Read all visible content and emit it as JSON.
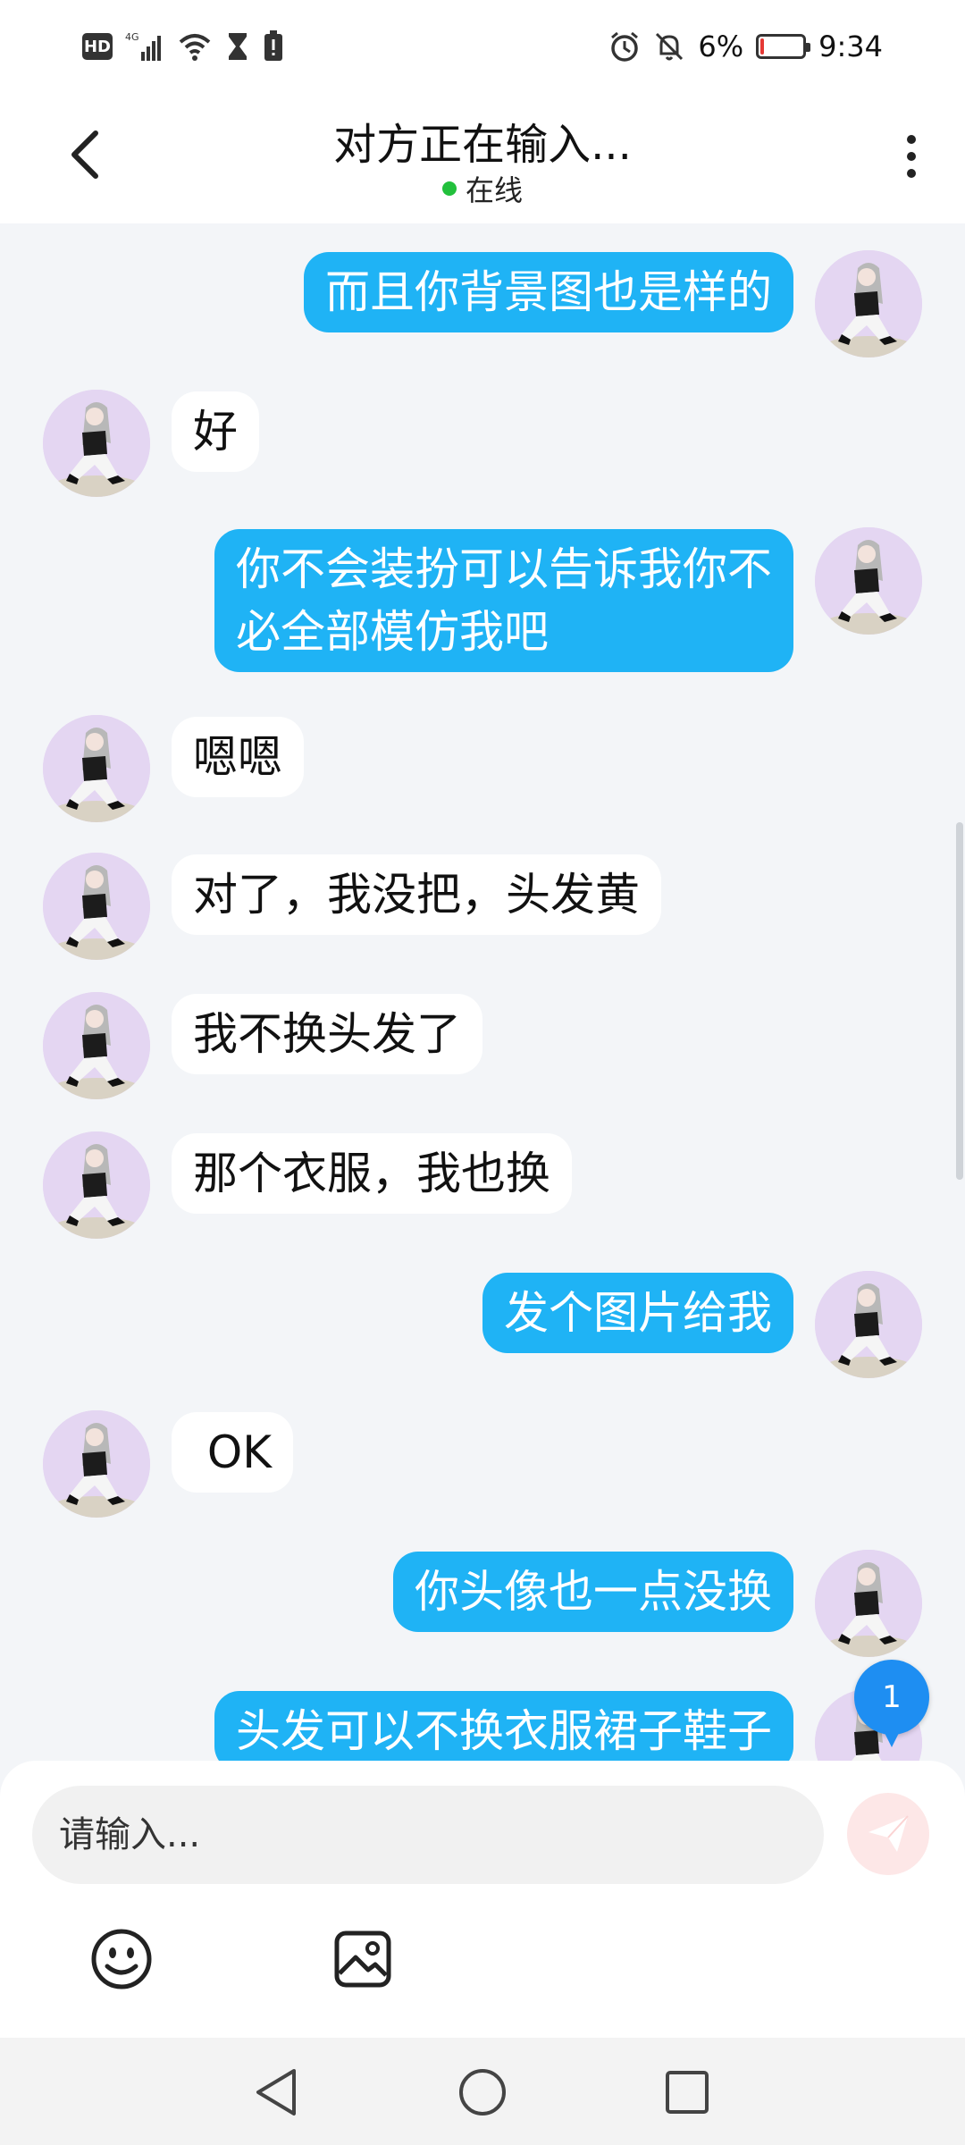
{
  "status_bar": {
    "hd": "HD",
    "network": "4G",
    "battery_percent": "6%",
    "battery_level": 0.06,
    "time": "9:34",
    "icons": [
      "signal-icon",
      "wifi-icon",
      "hourglass-icon",
      "alert-icon",
      "alarm-icon",
      "mute-icon",
      "battery-icon"
    ]
  },
  "header": {
    "title": "对方正在输入...",
    "status": "在线",
    "status_color": "#22c03c"
  },
  "messages": [
    {
      "side": "right",
      "text": "而且你背景图也是样的"
    },
    {
      "side": "left",
      "text": "好"
    },
    {
      "side": "right",
      "text": "你不会装扮可以告诉我你不\n必全部模仿我吧"
    },
    {
      "side": "left",
      "text": "嗯嗯"
    },
    {
      "side": "left",
      "text": "对了，我没把，头发黄"
    },
    {
      "side": "left",
      "text": "我不换头发了"
    },
    {
      "side": "left",
      "text": "那个衣服，我也换"
    },
    {
      "side": "right",
      "text": "发个图片给我"
    },
    {
      "side": "left",
      "text": " OK"
    },
    {
      "side": "right",
      "text": "你头像也一点没换"
    },
    {
      "side": "right",
      "text": "头发可以不换衣服裙子鞋子"
    }
  ],
  "unread_badge": "1",
  "composer": {
    "placeholder": "请输入..."
  },
  "colors": {
    "outgoing_bubble": "#1fb3f5",
    "incoming_bubble": "#ffffff",
    "background": "#f3f5f8",
    "unread_badge": "#1e8ef2"
  }
}
